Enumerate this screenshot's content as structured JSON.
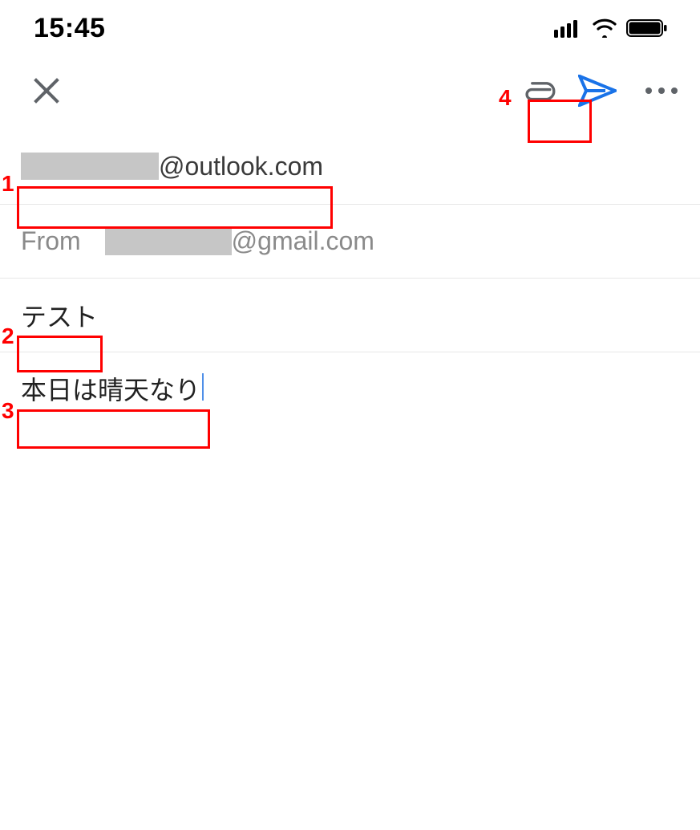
{
  "statusBar": {
    "time": "15:45"
  },
  "toolbar": {
    "closeLabel": "close",
    "attachLabel": "attach",
    "sendLabel": "send",
    "moreLabel": "more"
  },
  "compose": {
    "to": {
      "suffix": "@outlook.com"
    },
    "from": {
      "label": "From",
      "suffix": "@gmail.com"
    },
    "subject": "テスト",
    "body": "本日は晴天なり"
  },
  "annotations": {
    "n1": "1",
    "n2": "2",
    "n3": "3",
    "n4": "4"
  }
}
